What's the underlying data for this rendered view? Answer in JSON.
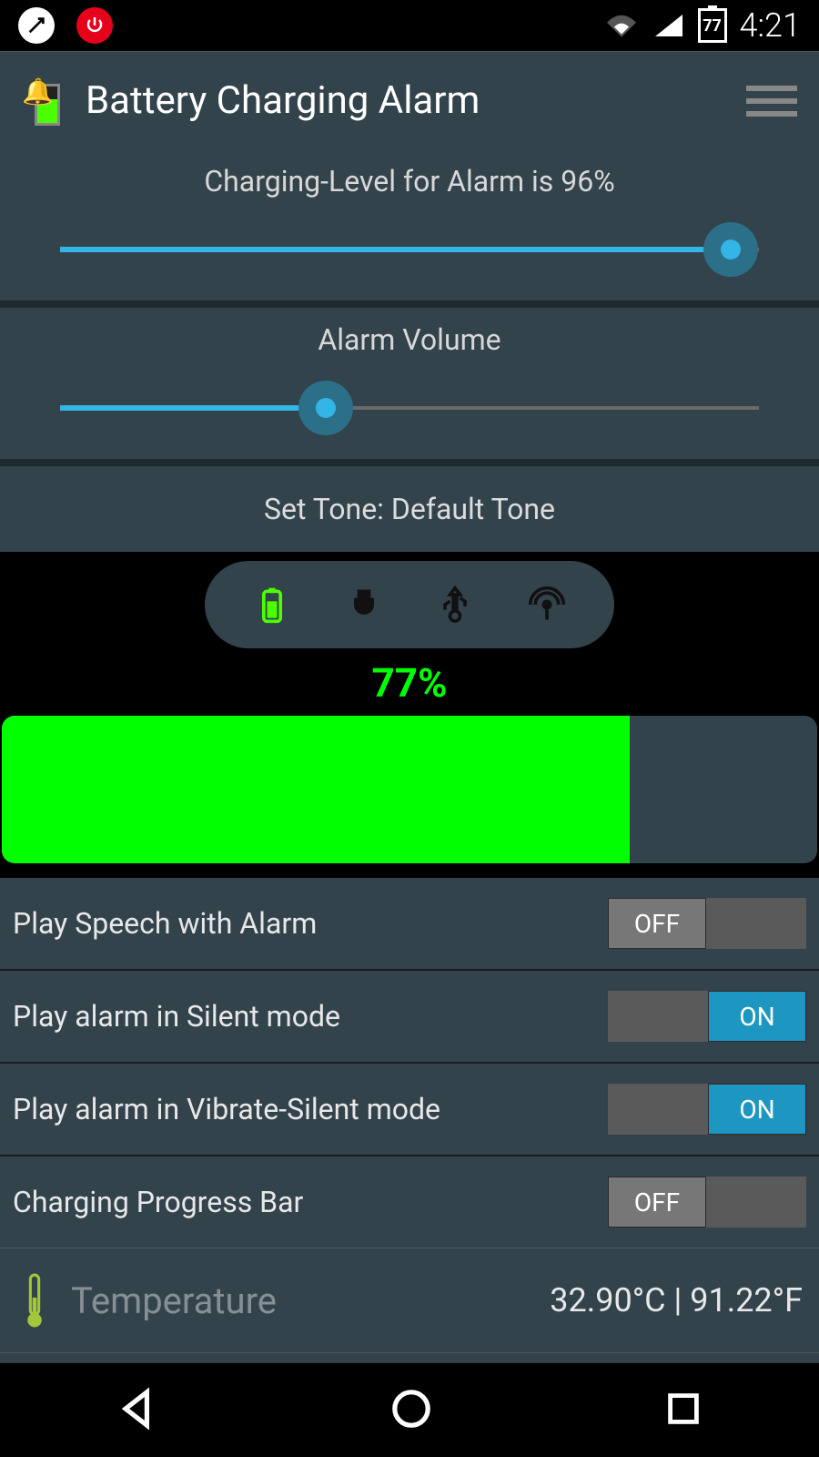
{
  "status": {
    "battery_icon_text": "77",
    "time": "4:21"
  },
  "appbar": {
    "title": "Battery Charging Alarm"
  },
  "level_slider": {
    "label": "Charging-Level for Alarm is 96%",
    "percent": 96
  },
  "volume_slider": {
    "label": "Alarm Volume",
    "percent": 38
  },
  "tone": {
    "label": "Set Tone: Default Tone"
  },
  "battery": {
    "percent_text": "77%",
    "percent": 77
  },
  "settings": {
    "rows": [
      {
        "label": "Play Speech with Alarm",
        "state": "OFF"
      },
      {
        "label": "Play alarm in Silent mode",
        "state": "ON"
      },
      {
        "label": "Play alarm in Vibrate-Silent mode",
        "state": "ON"
      },
      {
        "label": "Charging Progress Bar",
        "state": "OFF"
      }
    ],
    "off_text": "OFF",
    "on_text": "ON"
  },
  "temperature": {
    "label": "Temperature",
    "value": "32.90°C | 91.22°F"
  }
}
